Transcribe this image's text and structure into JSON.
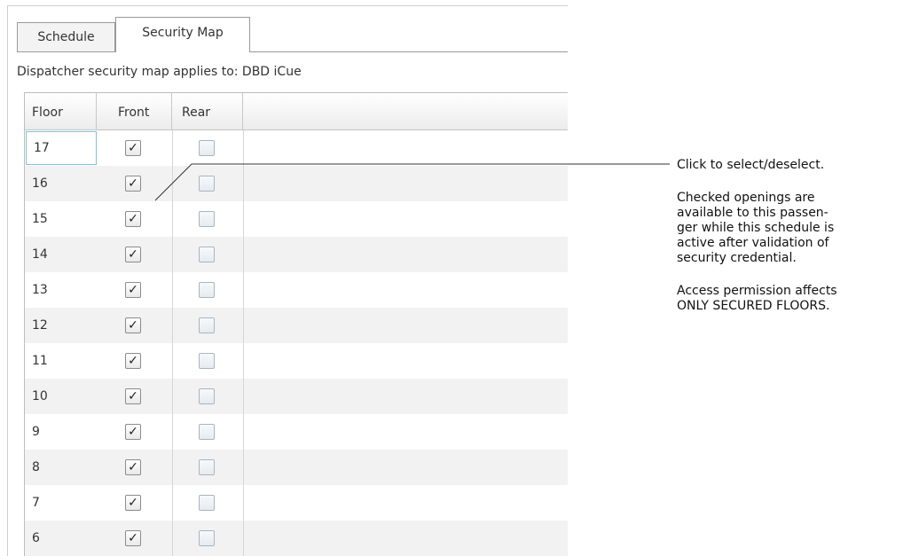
{
  "tabs": [
    {
      "label": "Schedule",
      "active": false
    },
    {
      "label": "Security Map",
      "active": true
    }
  ],
  "caption": "Dispatcher security map applies to: DBD iCue",
  "columns": {
    "floor": "Floor",
    "front": "Front",
    "rear": "Rear"
  },
  "check_glyph": "✓",
  "rows": [
    {
      "floor": "17",
      "front": true,
      "rear": false
    },
    {
      "floor": "16",
      "front": true,
      "rear": false
    },
    {
      "floor": "15",
      "front": true,
      "rear": false
    },
    {
      "floor": "14",
      "front": true,
      "rear": false
    },
    {
      "floor": "13",
      "front": true,
      "rear": false
    },
    {
      "floor": "12",
      "front": true,
      "rear": false
    },
    {
      "floor": "11",
      "front": true,
      "rear": false
    },
    {
      "floor": "10",
      "front": true,
      "rear": false
    },
    {
      "floor": "9",
      "front": true,
      "rear": false
    },
    {
      "floor": "8",
      "front": true,
      "rear": false
    },
    {
      "floor": "7",
      "front": true,
      "rear": false
    },
    {
      "floor": "6",
      "front": true,
      "rear": false
    }
  ],
  "callout": {
    "line1": "Click to select/deselect.",
    "line2": "Checked openings are\navailable to this passen-\nger while this schedule is\nactive after validation of\nsecurity credential.",
    "line3": "Access permission affects\nONLY SECURED FLOORS."
  }
}
